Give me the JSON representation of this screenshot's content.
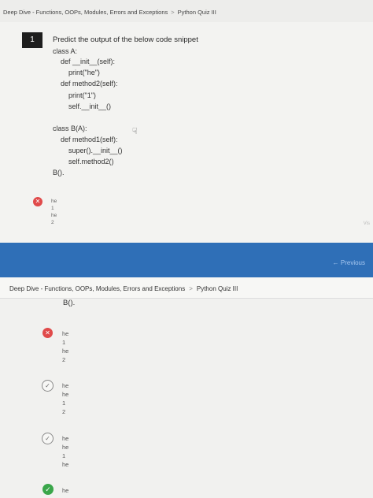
{
  "screen1": {
    "breadcrumb": [
      "Deep Dive - Functions, OOPs, Modules, Errors and Exceptions",
      "Python Quiz III"
    ],
    "breadcrumb_separator": ">",
    "question_number": "1",
    "prompt": "Predict the output of the below code snippet",
    "code_lines": [
      "class A:",
      "    def __init__(self):",
      "        print(\"he\")",
      "    def method2(self):",
      "        print(\"1\")",
      "        self.__init__()",
      "",
      "class B(A):",
      "    def method1(self):",
      "        super().__init__()",
      "        self.method2()",
      "B()."
    ],
    "option_wrong_lines": [
      "he",
      "1",
      "he",
      "2"
    ],
    "vis_text": "Vis",
    "previous_label": "← Previous"
  },
  "screen2": {
    "breadcrumb": [
      "Deep Dive - Functions, OOPs, Modules, Errors and Exceptions",
      "Python Quiz III"
    ],
    "breadcrumb_separator": ">",
    "code_tail": "B().",
    "options": [
      {
        "status": "wrong",
        "lines": [
          "he",
          "1",
          "he",
          "2"
        ]
      },
      {
        "status": "unselected",
        "lines": [
          "he",
          "he",
          "1",
          "2"
        ]
      },
      {
        "status": "unselected",
        "lines": [
          "he",
          "he",
          "1",
          "he"
        ]
      },
      {
        "status": "correct",
        "lines": [
          "he"
        ]
      }
    ]
  },
  "colors": {
    "footer_bar": "#2f6fb7",
    "wrong": "#e04a4a",
    "correct": "#3aa64a",
    "question_badge": "#1e1e1e"
  },
  "icons": [
    "wrong-x-icon",
    "radio-check-icon",
    "correct-check-icon",
    "hand-cursor-icon"
  ]
}
